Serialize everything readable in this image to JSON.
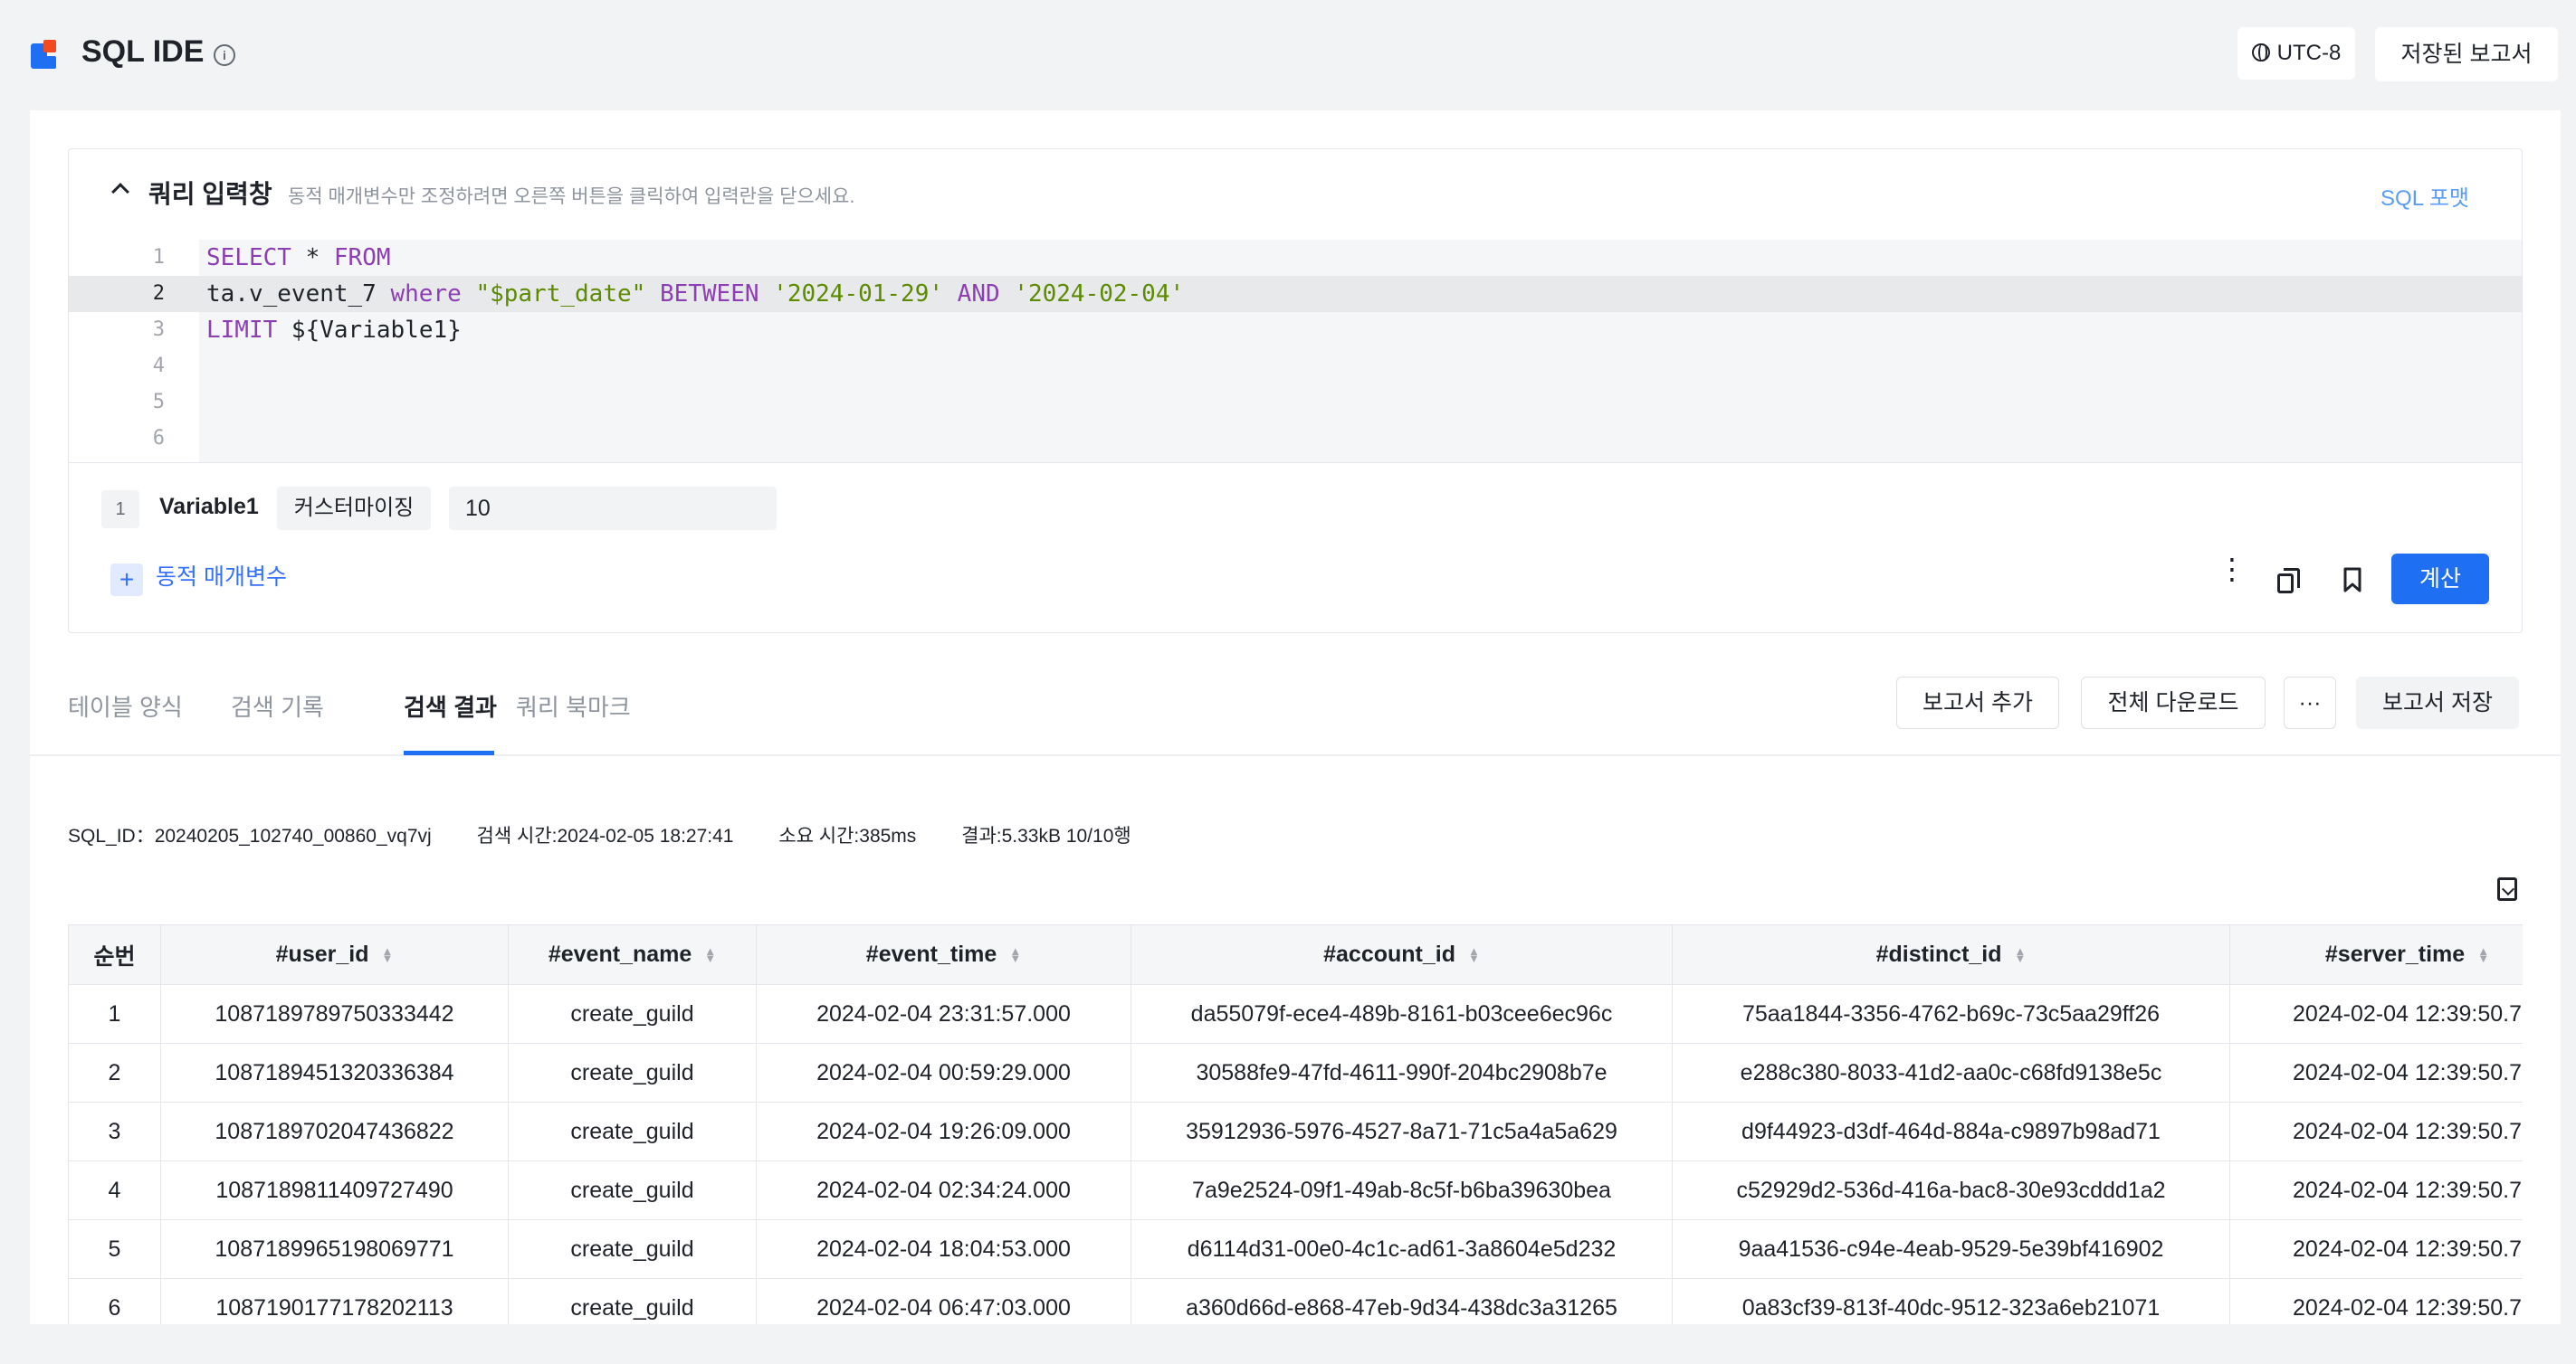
{
  "header": {
    "title": "SQL IDE",
    "timezone": "UTC-8",
    "saved_reports": "저장된 보고서"
  },
  "query_panel": {
    "title": "쿼리 입력창",
    "hint": "동적 매개변수만 조정하려면 오른쪽 버튼을 클릭하여 입력란을 닫으세요.",
    "sql_format": "SQL 포맷",
    "line_numbers": [
      "1",
      "2",
      "3",
      "4",
      "5",
      "6"
    ],
    "code": {
      "line1": {
        "kw1": "SELECT",
        "sep1": " * ",
        "kw2": "FROM"
      },
      "line2": {
        "table": "ta.v_event_7 ",
        "kw_where": "where",
        "sp1": " ",
        "col": "\"$part_date\"",
        "sp2": " ",
        "kw_between": "BETWEEN",
        "sp3": " ",
        "date1": "'2024-01-29'",
        "sp4": " ",
        "kw_and": "AND",
        "sp5": " ",
        "date2": "'2024-02-04'"
      },
      "line3": {
        "kw": "LIMIT",
        "rest": " ${Variable1}"
      }
    }
  },
  "params": {
    "index": "1",
    "name": "Variable1",
    "type": "커스터마이징",
    "value": "10",
    "add_label": "동적 매개변수",
    "calc_button": "계산"
  },
  "tabs": [
    {
      "label": "테이블 양식"
    },
    {
      "label": "검색 기록"
    },
    {
      "label": "검색 결과"
    },
    {
      "label": "쿼리 북마크"
    }
  ],
  "actions": {
    "add_report": "보고서 추가",
    "download_all": "전체 다운로드",
    "more": "···",
    "save_report": "보고서 저장"
  },
  "result_meta": {
    "sql_id": "SQL_ID：20240205_102740_00860_vq7vj",
    "search_time": "검색 시간:2024-02-05 18:27:41",
    "duration": "소요 시간:385ms",
    "result": "결과:5.33kB 10/10행"
  },
  "table": {
    "columns": [
      "순번",
      "#user_id",
      "#event_name",
      "#event_time",
      "#account_id",
      "#distinct_id",
      "#server_time"
    ],
    "rows": [
      [
        "1",
        "1087189789750333442",
        "create_guild",
        "2024-02-04 23:31:57.000",
        "da55079f-ece4-489b-8161-b03cee6ec96c",
        "75aa1844-3356-4762-b69c-73c5aa29ff26",
        "2024-02-04 12:39:50.7"
      ],
      [
        "2",
        "1087189451320336384",
        "create_guild",
        "2024-02-04 00:59:29.000",
        "30588fe9-47fd-4611-990f-204bc2908b7e",
        "e288c380-8033-41d2-aa0c-c68fd9138e5c",
        "2024-02-04 12:39:50.7"
      ],
      [
        "3",
        "1087189702047436822",
        "create_guild",
        "2024-02-04 19:26:09.000",
        "35912936-5976-4527-8a71-71c5a4a5a629",
        "d9f44923-d3df-464d-884a-c9897b98ad71",
        "2024-02-04 12:39:50.7"
      ],
      [
        "4",
        "1087189811409727490",
        "create_guild",
        "2024-02-04 02:34:24.000",
        "7a9e2524-09f1-49ab-8c5f-b6ba39630bea",
        "c52929d2-536d-416a-bac8-30e93cddd1a2",
        "2024-02-04 12:39:50.7"
      ],
      [
        "5",
        "1087189965198069771",
        "create_guild",
        "2024-02-04 18:04:53.000",
        "d6114d31-00e0-4c1c-ad61-3a8604e5d232",
        "9aa41536-c94e-4eab-9529-5e39bf416902",
        "2024-02-04 12:39:50.7"
      ],
      [
        "6",
        "1087190177178202113",
        "create_guild",
        "2024-02-04 06:47:03.000",
        "a360d66d-e868-47eb-9d34-438dc3a31265",
        "0a83cf39-813f-40dc-9512-323a6eb21071",
        "2024-02-04 12:39:50.7"
      ]
    ]
  }
}
